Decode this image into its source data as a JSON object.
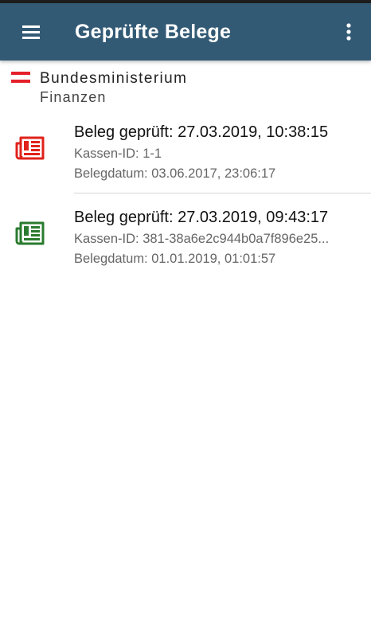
{
  "app_bar": {
    "title": "Geprüfte Belege",
    "background_color": "#335a75",
    "menu_icon": "hamburger-menu-icon",
    "overflow_icon": "more-vert-icon"
  },
  "logo": {
    "line1": "Bundesministerium",
    "line2": "Finanzen",
    "flag_colors": [
      "#e4202b",
      "#ffffff",
      "#e4202b"
    ]
  },
  "receipts": [
    {
      "title": "Beleg geprüft: 27.03.2019, 10:38:15",
      "kassen_id": "Kassen-ID: 1-1",
      "belegdatum": "Belegdatum: 03.06.2017, 23:06:17",
      "status_color": "#e0221b",
      "icon": "receipt-invalid-icon"
    },
    {
      "title": "Beleg geprüft: 27.03.2019, 09:43:17",
      "kassen_id": "Kassen-ID: 381-38a6e2c944b0a7f896e25...",
      "belegdatum": "Belegdatum: 01.01.2019, 01:01:57",
      "status_color": "#2a7b2f",
      "icon": "receipt-valid-icon"
    }
  ]
}
